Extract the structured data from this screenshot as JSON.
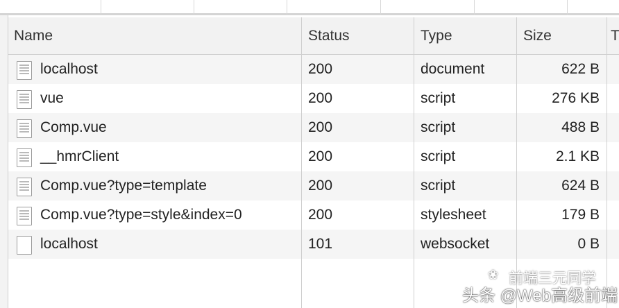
{
  "columns": [
    "Name",
    "Status",
    "Type",
    "Size",
    "T"
  ],
  "rows": [
    {
      "name": "localhost",
      "status": "200",
      "type": "document",
      "size": "622 B",
      "icon": "document-icon"
    },
    {
      "name": "vue",
      "status": "200",
      "type": "script",
      "size": "276 KB",
      "icon": "document-icon"
    },
    {
      "name": "Comp.vue",
      "status": "200",
      "type": "script",
      "size": "488 B",
      "icon": "document-icon"
    },
    {
      "name": "__hmrClient",
      "status": "200",
      "type": "script",
      "size": "2.1 KB",
      "icon": "document-icon"
    },
    {
      "name": "Comp.vue?type=template",
      "status": "200",
      "type": "script",
      "size": "624 B",
      "icon": "document-icon"
    },
    {
      "name": "Comp.vue?type=style&index=0",
      "status": "200",
      "type": "stylesheet",
      "size": "179 B",
      "icon": "document-icon"
    },
    {
      "name": "localhost",
      "status": "101",
      "type": "websocket",
      "size": "0 B",
      "icon": "blank-file-icon"
    }
  ],
  "watermark": {
    "line1": "前端三元同学",
    "line2": "头条 @Web高级前端"
  }
}
